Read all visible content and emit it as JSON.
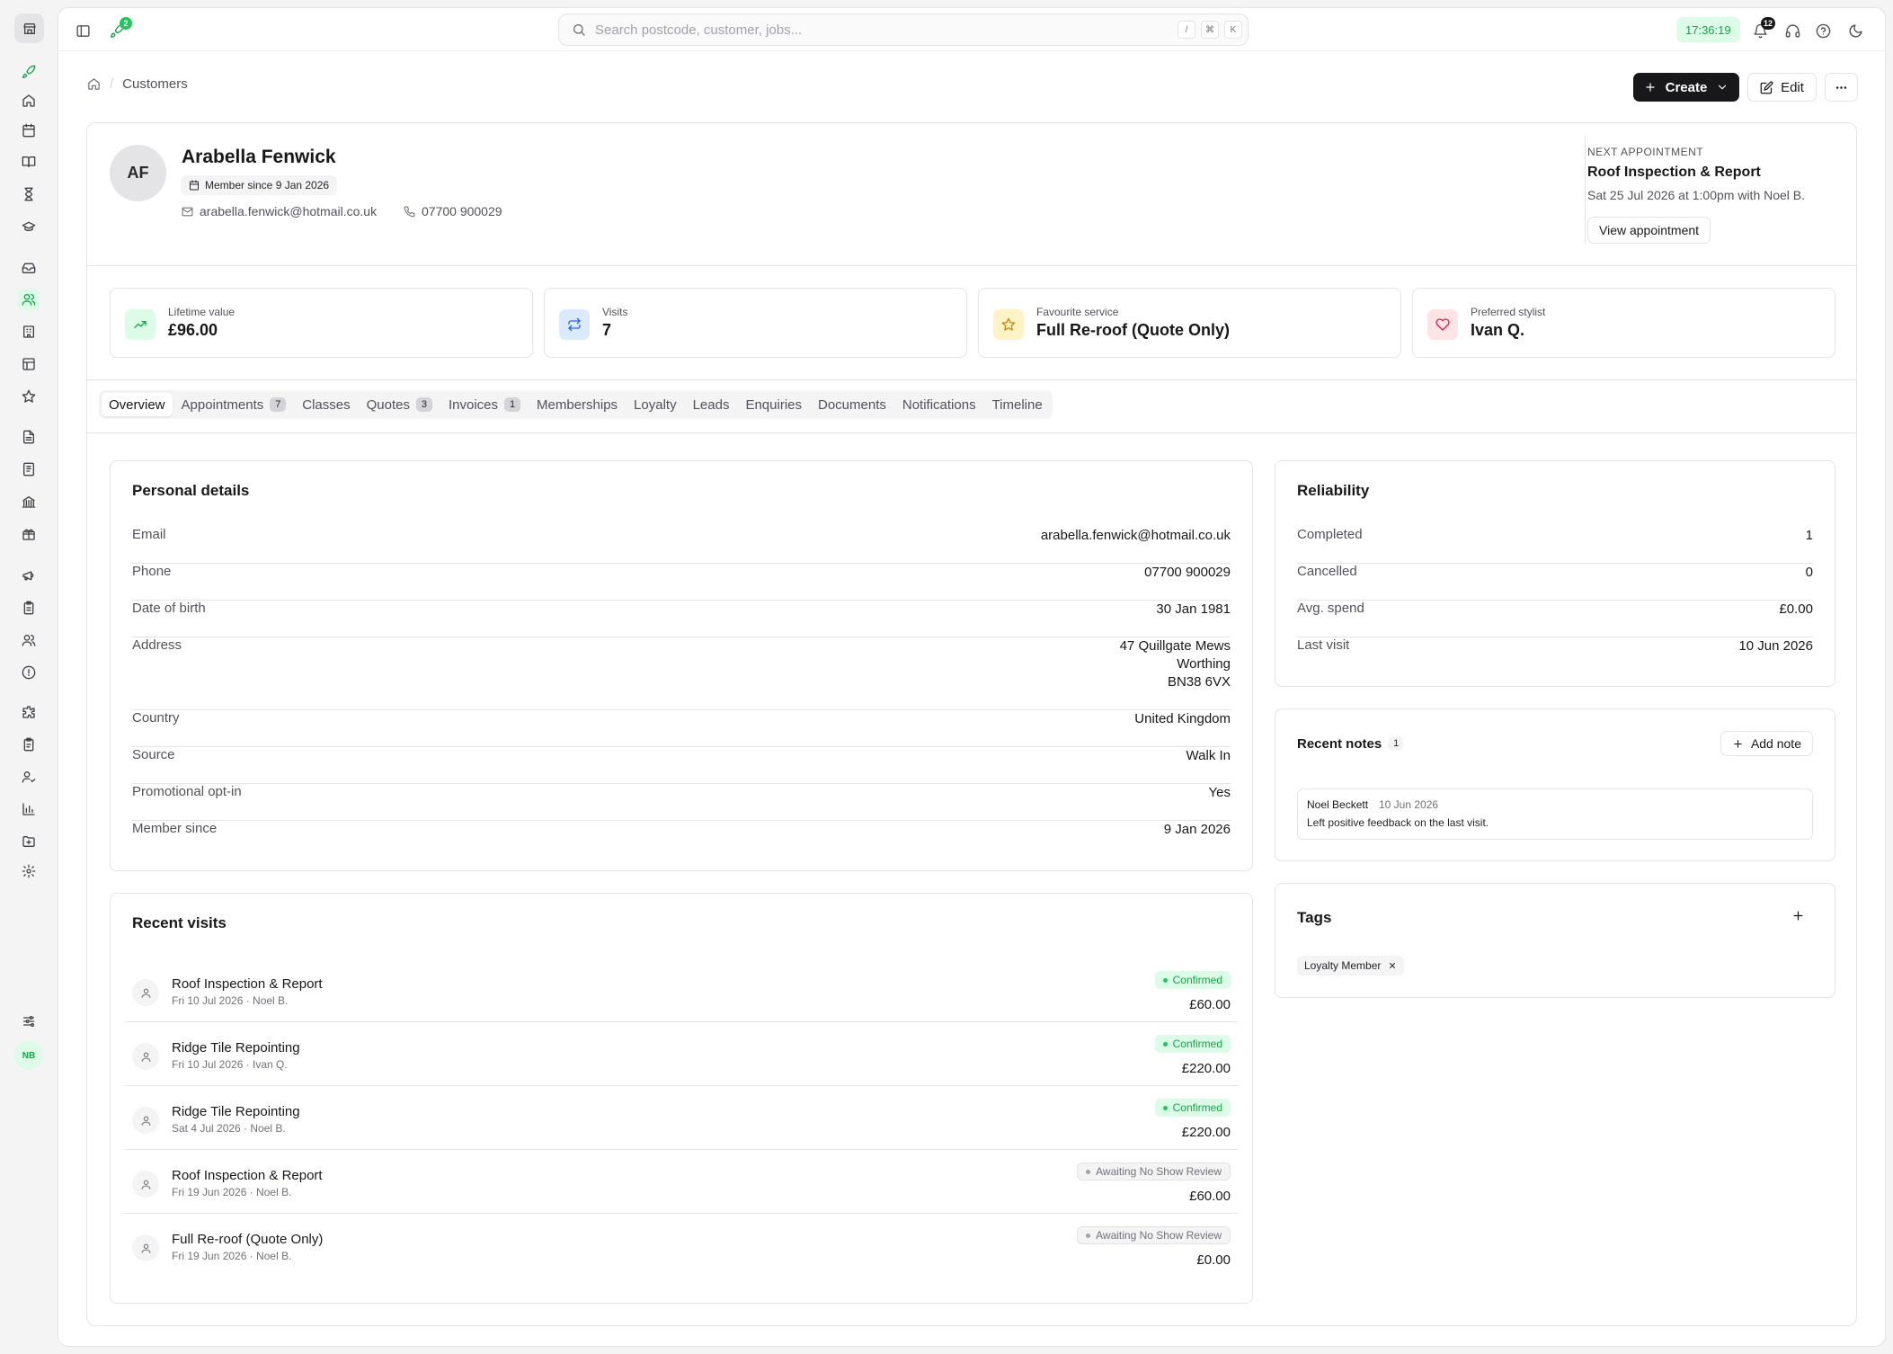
{
  "topbar": {
    "rocket_badge": "2",
    "search_placeholder": "Search postcode, customer, jobs...",
    "shortcut_keys": [
      "/",
      "⌘",
      "K"
    ],
    "clock": "17:36:19",
    "notifications_count": "12"
  },
  "sidebar": {
    "user_initials": "NB"
  },
  "breadcrumb": {
    "current": "Customers"
  },
  "actions": {
    "create_label": "Create",
    "edit_label": "Edit"
  },
  "customer": {
    "initials": "AF",
    "name": "Arabella Fenwick",
    "member_since_label": "Member since 9 Jan 2026",
    "email": "arabella.fenwick@hotmail.co.uk",
    "phone": "07700 900029"
  },
  "next_appointment": {
    "label": "NEXT APPOINTMENT",
    "title": "Roof Inspection & Report",
    "detail": "Sat 25 Jul 2026 at 1:00pm with Noel B.",
    "button_label": "View appointment"
  },
  "stats": [
    {
      "label": "Lifetime value",
      "value": "£96.00",
      "icon": "trending-up-icon",
      "color": "#16a34a",
      "bg": "#dcfce7"
    },
    {
      "label": "Visits",
      "value": "7",
      "icon": "repeat-icon",
      "color": "#2563eb",
      "bg": "#dbeafe"
    },
    {
      "label": "Favourite service",
      "value": "Full Re-roof (Quote Only)",
      "icon": "star-icon",
      "color": "#ca8a04",
      "bg": "#fef3c7"
    },
    {
      "label": "Preferred stylist",
      "value": "Ivan Q.",
      "icon": "heart-icon",
      "color": "#e11d48",
      "bg": "#ffe4e6"
    }
  ],
  "tabs": [
    {
      "label": "Overview",
      "count": ""
    },
    {
      "label": "Appointments",
      "count": "7"
    },
    {
      "label": "Classes",
      "count": ""
    },
    {
      "label": "Quotes",
      "count": "3"
    },
    {
      "label": "Invoices",
      "count": "1"
    },
    {
      "label": "Memberships",
      "count": ""
    },
    {
      "label": "Loyalty",
      "count": ""
    },
    {
      "label": "Leads",
      "count": ""
    },
    {
      "label": "Enquiries",
      "count": ""
    },
    {
      "label": "Documents",
      "count": ""
    },
    {
      "label": "Notifications",
      "count": ""
    },
    {
      "label": "Timeline",
      "count": ""
    }
  ],
  "personal_details": {
    "title": "Personal details",
    "rows": [
      {
        "label": "Email",
        "value": "arabella.fenwick@hotmail.co.uk"
      },
      {
        "label": "Phone",
        "value": "07700 900029"
      },
      {
        "label": "Date of birth",
        "value": "30 Jan 1981"
      },
      {
        "label": "Address",
        "lines": [
          "47 Quillgate Mews",
          "Worthing",
          "BN38 6VX"
        ]
      },
      {
        "label": "Country",
        "value": "United Kingdom"
      },
      {
        "label": "Source",
        "value": "Walk In"
      },
      {
        "label": "Promotional opt-in",
        "value": "Yes"
      },
      {
        "label": "Member since",
        "value": "9 Jan 2026"
      }
    ]
  },
  "recent_visits": {
    "title": "Recent visits",
    "items": [
      {
        "service": "Roof Inspection & Report",
        "meta": "Fri 10 Jul 2026 · Noel B.",
        "status": "Confirmed",
        "status_type": "green",
        "amount": "£60.00"
      },
      {
        "service": "Ridge Tile Repointing",
        "meta": "Fri 10 Jul 2026 · Ivan Q.",
        "status": "Confirmed",
        "status_type": "green",
        "amount": "£220.00"
      },
      {
        "service": "Ridge Tile Repointing",
        "meta": "Sat 4 Jul 2026 · Noel B.",
        "status": "Confirmed",
        "status_type": "green",
        "amount": "£220.00"
      },
      {
        "service": "Roof Inspection & Report",
        "meta": "Fri 19 Jun 2026 · Noel B.",
        "status": "Awaiting No Show Review",
        "status_type": "gray",
        "amount": "£60.00"
      },
      {
        "service": "Full Re-roof (Quote Only)",
        "meta": "Fri 19 Jun 2026 · Noel B.",
        "status": "Awaiting No Show Review",
        "status_type": "gray",
        "amount": "£0.00"
      }
    ]
  },
  "reliability": {
    "title": "Reliability",
    "rows": [
      {
        "label": "Completed",
        "value": "1"
      },
      {
        "label": "Cancelled",
        "value": "0"
      },
      {
        "label": "Avg. spend",
        "value": "£0.00"
      },
      {
        "label": "Last visit",
        "value": "10 Jun 2026"
      }
    ]
  },
  "recent_notes": {
    "title": "Recent notes",
    "count": "1",
    "add_label": "Add note",
    "notes": [
      {
        "author": "Noel Beckett",
        "date": "10 Jun 2026",
        "text": "Left positive feedback on the last visit."
      }
    ]
  },
  "tags": {
    "title": "Tags",
    "items": [
      "Loyalty Member"
    ]
  }
}
